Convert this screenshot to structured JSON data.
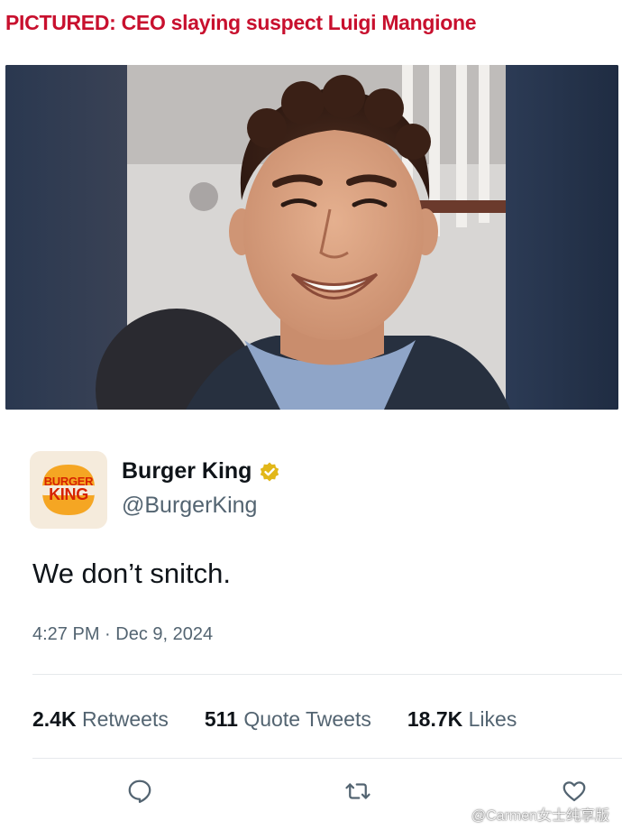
{
  "headline": "PICTURED: CEO slaying suspect Luigi Mangione",
  "tweet": {
    "avatar_text": [
      "BURGER",
      "KING"
    ],
    "display_name": "Burger King",
    "verified_badge": "gold-check",
    "handle": "@BurgerKing",
    "text": "We don’t snitch.",
    "timestamp": "4:27 PM · Dec 9, 2024",
    "stats": {
      "retweets_count": "2.4K",
      "retweets_label": "Retweets",
      "quotes_count": "511",
      "quotes_label": "Quote Tweets",
      "likes_count": "18.7K",
      "likes_label": "Likes"
    },
    "actions": [
      "reply-icon",
      "retweet-icon",
      "like-icon"
    ]
  },
  "watermark": "@Carmen女士纯享版",
  "colors": {
    "headline": "#c8102e",
    "verified": "#e2b719",
    "bk_orange": "#f5a623",
    "bk_red": "#d62300",
    "text_secondary": "#536471"
  }
}
